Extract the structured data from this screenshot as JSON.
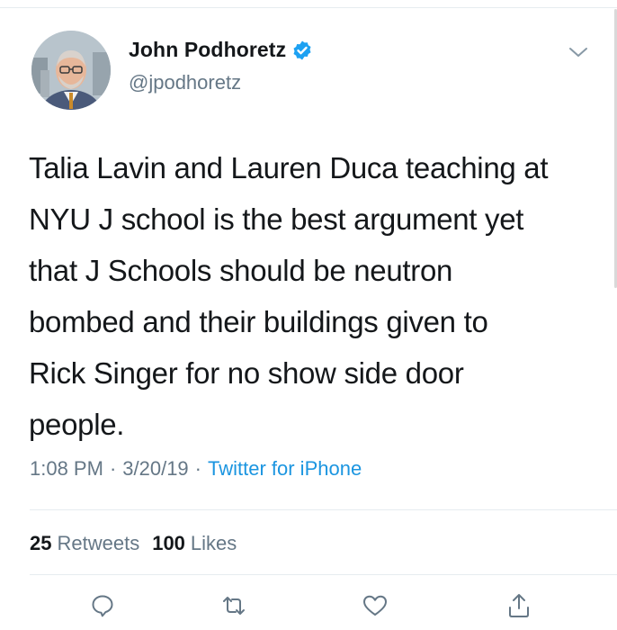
{
  "tweet": {
    "display_name": "John Podhoretz",
    "handle": "@jpodhoretz",
    "verified": true,
    "text_lines": [
      "Talia Lavin and Lauren Duca teaching at",
      "NYU J school is the best argument yet",
      "that J Schools should be neutron",
      "bombed and their buildings given to",
      "Rick Singer for no show side door",
      "people."
    ],
    "time": "1:08 PM",
    "date": "3/20/19",
    "source": "Twitter for iPhone",
    "separator": "·"
  },
  "stats": {
    "retweets_count": "25",
    "retweets_label": "Retweets",
    "likes_count": "100",
    "likes_label": "Likes"
  },
  "icons": {
    "verified": "verified-badge-icon",
    "more": "chevron-down-icon",
    "reply": "reply-icon",
    "retweet": "retweet-icon",
    "like": "heart-icon",
    "share": "share-icon"
  },
  "colors": {
    "accent": "#1b95e0",
    "text": "#14171a",
    "secondary": "#657786",
    "divider": "#e6ecf0"
  }
}
